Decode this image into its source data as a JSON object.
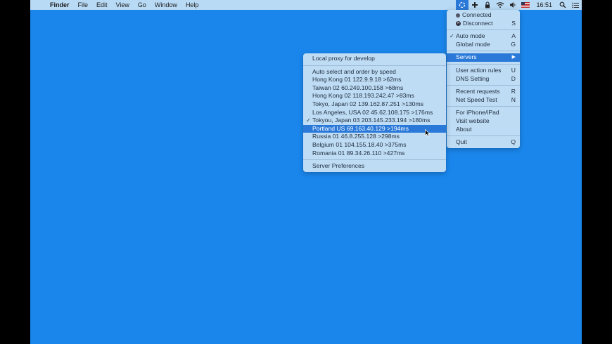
{
  "menubar": {
    "apple": "",
    "items": [
      "Finder",
      "File",
      "Edit",
      "View",
      "Go",
      "Window",
      "Help"
    ],
    "clock": "16:51"
  },
  "main_menu": {
    "connected": "Connected",
    "disconnect": {
      "label": "Disconnect",
      "key": "S"
    },
    "auto_mode": {
      "label": "Auto mode",
      "key": "A",
      "check": "✓"
    },
    "global_mode": {
      "label": "Global mode",
      "key": "G"
    },
    "servers": {
      "label": "Servers",
      "arrow": "▶"
    },
    "user_action_rules": {
      "label": "User action rules",
      "key": "U"
    },
    "dns_setting": {
      "label": "DNS Setting",
      "key": "D"
    },
    "recent_requests": {
      "label": "Recent requests",
      "key": "R"
    },
    "net_speed_test": {
      "label": "Net Speed Test",
      "key": "N"
    },
    "for_iphone": {
      "label": "For iPhone/iPad"
    },
    "visit_website": {
      "label": "Visit website"
    },
    "about": {
      "label": "About"
    },
    "quit": {
      "label": "Quit",
      "key": "Q"
    }
  },
  "server_menu": {
    "local_proxy": "Local proxy for develop",
    "auto_select": "Auto select and order by speed",
    "servers": [
      {
        "label": "Hong Kong 01  122.9.9.18  >62ms",
        "check": ""
      },
      {
        "label": "Taiwan 02  60.249.100.158  >68ms",
        "check": ""
      },
      {
        "label": "Hong Kong 02  118.193.242.47  >83ms",
        "check": ""
      },
      {
        "label": "Tokyo, Japan 02  139.162.87.251  >130ms",
        "check": ""
      },
      {
        "label": "Los Angeles, USA 02  45.62.108.175  >176ms",
        "check": ""
      },
      {
        "label": "Tokyou, Japan 03  203.145.233.194  >180ms",
        "check": "✓"
      },
      {
        "label": "Portland US  69.163.40.129  >194ms",
        "check": ""
      },
      {
        "label": "Russia 01  46.8.255.128  >298ms",
        "check": ""
      },
      {
        "label": "Belgium 01  104.155.18.40  >375ms",
        "check": ""
      },
      {
        "label": "Romania 01  89.34.26.110  >427ms",
        "check": ""
      }
    ],
    "preferences": "Server Preferences"
  }
}
